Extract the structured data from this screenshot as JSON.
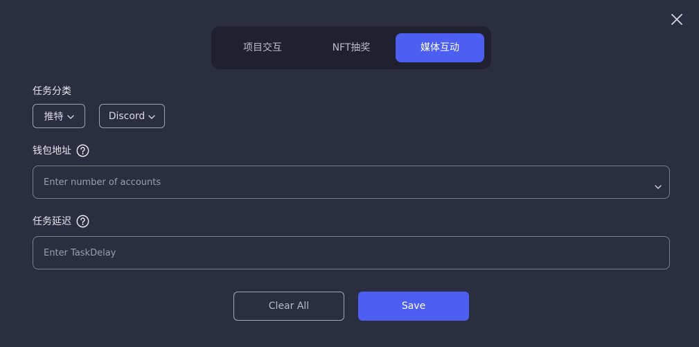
{
  "tabs": [
    {
      "label": "项目交互",
      "active": false
    },
    {
      "label": "NFT抽奖",
      "active": false
    },
    {
      "label": "媒体互动",
      "active": true
    }
  ],
  "task_category": {
    "label": "任务分类",
    "options": [
      "推特",
      "Discord"
    ]
  },
  "wallet_address": {
    "label": "钱包地址",
    "placeholder": "Enter number of accounts"
  },
  "task_delay": {
    "label": "任务延迟",
    "placeholder": "Enter TaskDelay"
  },
  "actions": {
    "clear_label": "Clear All",
    "save_label": "Save"
  },
  "icons": {
    "close": "close-icon",
    "help": "help-icon",
    "chevron": "chevron-down-icon"
  },
  "colors": {
    "background": "#2b2e40",
    "tab_bar": "#1f2131",
    "accent": "#4c5ff0"
  }
}
